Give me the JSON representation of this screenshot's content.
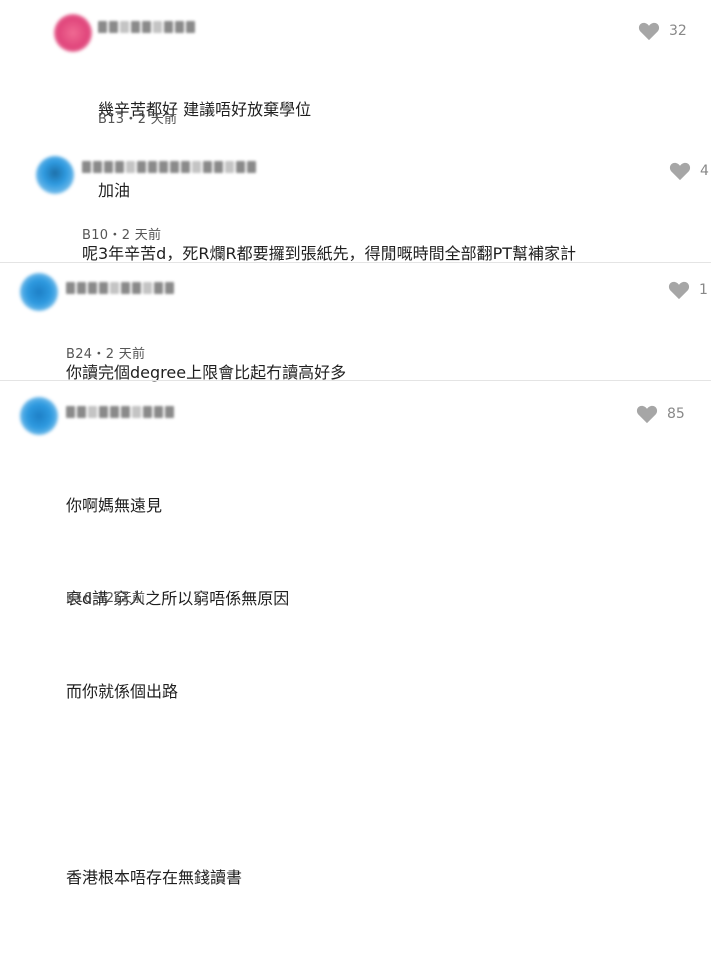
{
  "comments": [
    {
      "avatar_color": "#e0457b",
      "lines": [
        "幾辛苦都好 建議唔好放棄學位",
        "加油"
      ],
      "floor": "B13",
      "time": "2 天前",
      "likes": "32"
    },
    {
      "avatar_color": "#2e9ae0",
      "lines": [
        "呢3年辛苦d，死R爛R都要攞到張紙先，得閒嘅時間全部翻PT幫補家計"
      ],
      "floor": "B10",
      "time": "2 天前",
      "likes": "4"
    },
    {
      "avatar_color": "#2e9ae0",
      "lines": [
        "你讀完個degree上限會比起冇讀高好多"
      ],
      "floor": "B24",
      "time": "2 天前",
      "likes": "1"
    },
    {
      "avatar_color": "#2e9ae0",
      "lines": [
        "你啊媽無遠見",
        "衰d講 窮人之所以窮唔係無原因",
        "而你就係個出路",
        "",
        "香港根本唔存在無錢讀書"
      ],
      "floor": "B16",
      "time": "2 天前",
      "likes": "85"
    }
  ],
  "meta_separator": "・",
  "icons": {
    "like": "heart-icon"
  },
  "colors": {
    "like_icon": "#a6a6a6",
    "divider": "#e4e4e4"
  }
}
